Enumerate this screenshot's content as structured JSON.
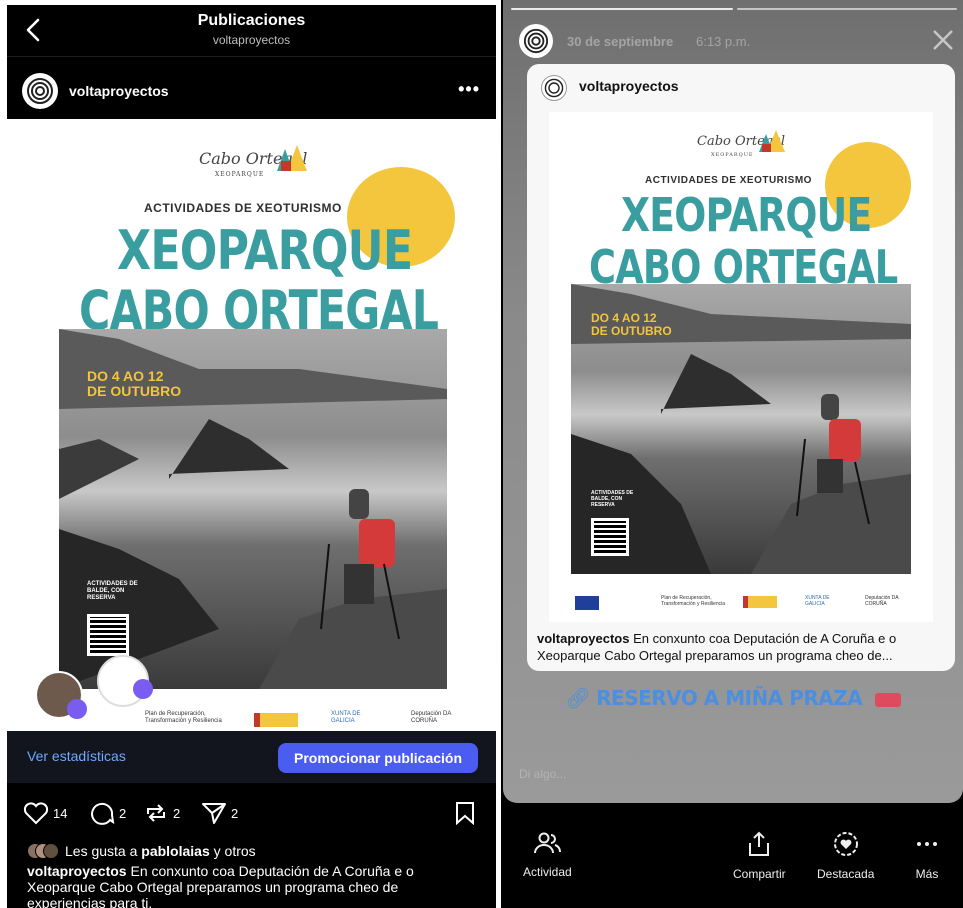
{
  "left": {
    "header": {
      "title": "Publicaciones",
      "subtitle": "voltaproyectos"
    },
    "account": {
      "username": "voltaproyectos",
      "more": "•••"
    },
    "poster": {
      "logo": "Cabo Ortegal",
      "logo_sub": "XEOPARQUE",
      "kicker": "ACTIVIDADES DE XEOTURISMO",
      "title_line1": "XEOPARQUE",
      "title_line2": "CABO ORTEGAL",
      "dates_line1": "DO 4 AO 12",
      "dates_line2": "DE OUTUBRO",
      "qr_label": "ACTIVIDADES DE BALDE, CON RESERVA",
      "sponsors": [
        "Plan de Recuperación, Transformación y Resiliencia",
        "XUNTA DE GALICIA",
        "Deputación DA CORUÑA"
      ]
    },
    "actionbar": {
      "stats": "Ver estadísticas",
      "promote": "Promocionar publicación"
    },
    "counts": {
      "likes": "14",
      "comments": "2",
      "reposts": "2",
      "shares": "2"
    },
    "likes_text_pre": "Les gusta a ",
    "likes_user": "pablolaias",
    "likes_text_post": " y otros",
    "caption_user": "voltaproyectos",
    "caption_text": " En conxunto coa Deputación de A Coruña e o Xeoparque Cabo Ortegal preparamos un programa cheo de experiencias para ti."
  },
  "right": {
    "date": "30 de septiembre",
    "time": "6:13 p.m.",
    "card": {
      "username": "voltaproyectos",
      "caption_user": "voltaproyectos",
      "caption_text": " En conxunto coa Deputación de A Coruña e o Xeoparque Cabo Ortegal preparamos un programa cheo de..."
    },
    "link_text": "RESERVO A MIÑA PRAZA",
    "reply_placeholder": "Di algo...",
    "bottom": {
      "activity": "Actividad",
      "share": "Compartir",
      "highlight": "Destacada",
      "more": "Más"
    }
  },
  "colors": {
    "teal": "#3a9ea0",
    "sun": "#f4c63d",
    "promote": "#4b5cf0",
    "link": "#4c8fe0"
  }
}
